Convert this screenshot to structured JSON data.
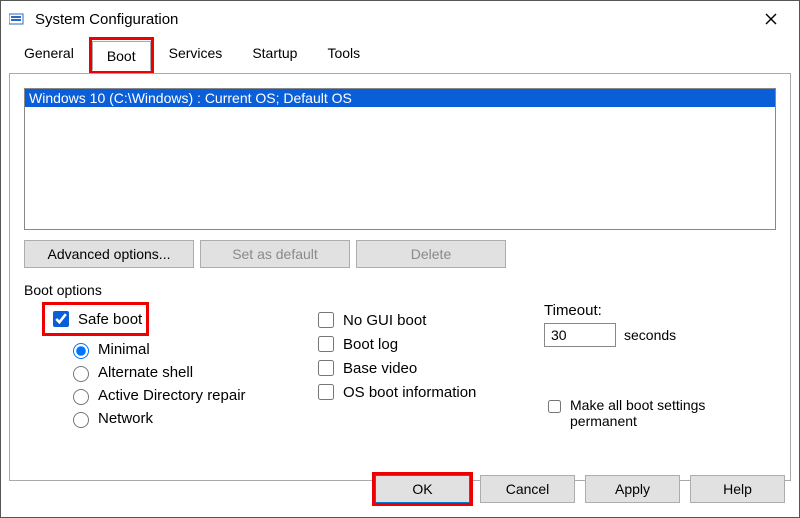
{
  "window": {
    "title": "System Configuration"
  },
  "tabs": {
    "general": "General",
    "boot": "Boot",
    "services": "Services",
    "startup": "Startup",
    "tools": "Tools"
  },
  "os_list": {
    "items": [
      "Windows 10 (C:\\Windows) : Current OS; Default OS"
    ]
  },
  "buttons": {
    "advanced": "Advanced options...",
    "set_default": "Set as default",
    "delete": "Delete",
    "ok": "OK",
    "cancel": "Cancel",
    "apply": "Apply",
    "help": "Help"
  },
  "boot_options": {
    "label": "Boot options",
    "safe_boot": "Safe boot",
    "minimal": "Minimal",
    "alternate_shell": "Alternate shell",
    "ad_repair": "Active Directory repair",
    "network": "Network",
    "no_gui": "No GUI boot",
    "boot_log": "Boot log",
    "base_video": "Base video",
    "os_info": "OS boot information"
  },
  "timeout": {
    "label": "Timeout:",
    "value": "30",
    "unit": "seconds"
  },
  "permanent": "Make all boot settings permanent"
}
